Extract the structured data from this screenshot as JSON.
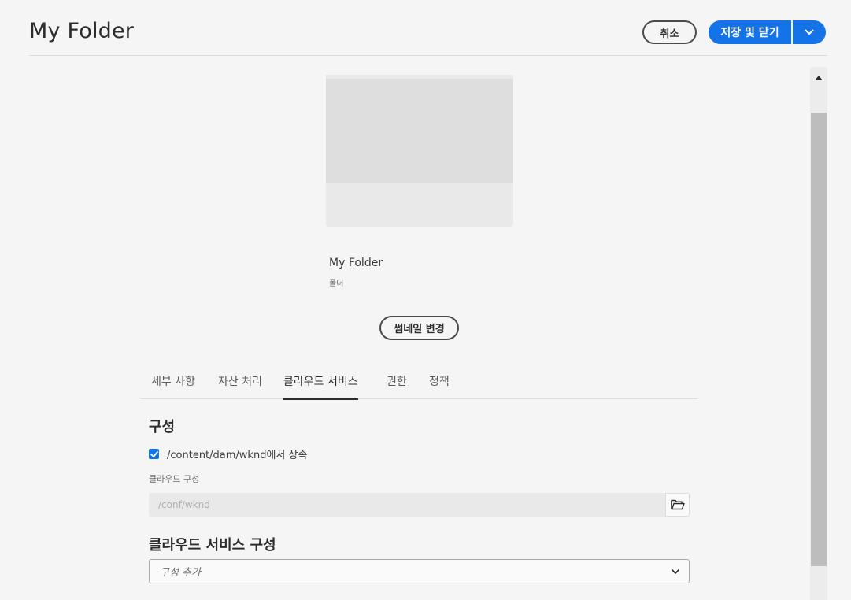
{
  "header": {
    "title": "My Folder",
    "cancel_label": "취소",
    "save_label": "저장 및 닫기",
    "save_menu_icon": "chevron-down-icon"
  },
  "asset": {
    "name": "My Folder",
    "type": "폴더",
    "change_thumbnail_label": "썸네일 변경"
  },
  "tabs": [
    {
      "label": "세부 사항",
      "active": false
    },
    {
      "label": "자산 처리",
      "active": false
    },
    {
      "label": "클라우드 서비스",
      "active": true
    },
    {
      "label": "권한",
      "active": false
    },
    {
      "label": "정책",
      "active": false
    }
  ],
  "configuration": {
    "title": "구성",
    "inherit_label": "/content/dam/wknd에서 상속",
    "inherit_checked": true,
    "cloud_config_label": "클라우드 구성",
    "cloud_config_value": "/conf/wknd",
    "browse_icon": "folder-open-icon"
  },
  "cloud_services": {
    "title": "클라우드 서비스 구성",
    "placeholder": "구성 추가"
  },
  "colors": {
    "accent": "#1473e6",
    "background": "#f5f5f5"
  }
}
